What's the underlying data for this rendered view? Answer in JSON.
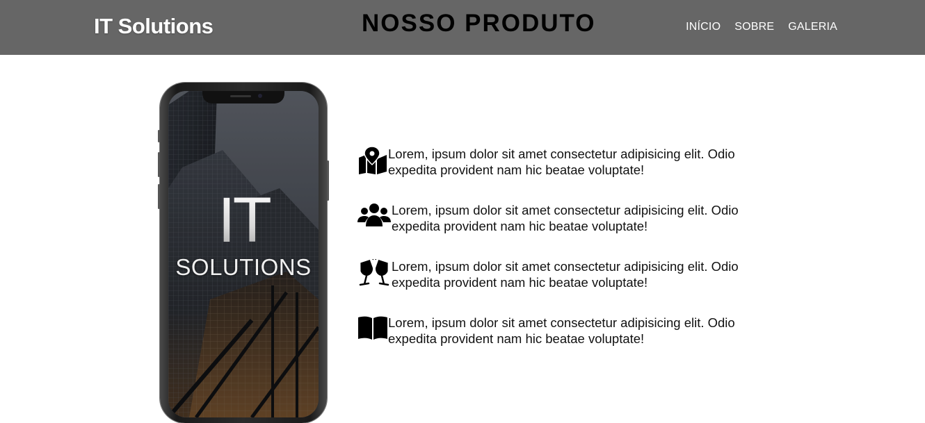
{
  "header": {
    "brand": "IT Solutions",
    "page_title": "NOSSO PRODUTO",
    "nav": [
      "INÍCIO",
      "SOBRE",
      "GALERIA"
    ],
    "background_color": "#666666"
  },
  "phone": {
    "screen_title_line1": "IT",
    "screen_title_line2": "SOLUTIONS"
  },
  "features": [
    {
      "icon": "map-marker-icon",
      "text": "Lorem, ipsum dolor sit amet consectetur adipisicing elit. Odio expedita provident nam hic beatae voluptate!"
    },
    {
      "icon": "users-icon",
      "text": "Lorem, ipsum dolor sit amet consectetur adipisicing elit. Odio expedita provident nam hic beatae voluptate!"
    },
    {
      "icon": "wine-glasses-icon",
      "text": "Lorem, ipsum dolor sit amet consectetur adipisicing elit. Odio expedita provident nam hic beatae voluptate!"
    },
    {
      "icon": "book-open-icon",
      "text": "Lorem, ipsum dolor sit amet consectetur adipisicing elit. Odio expedita provident nam hic beatae voluptate!"
    }
  ]
}
